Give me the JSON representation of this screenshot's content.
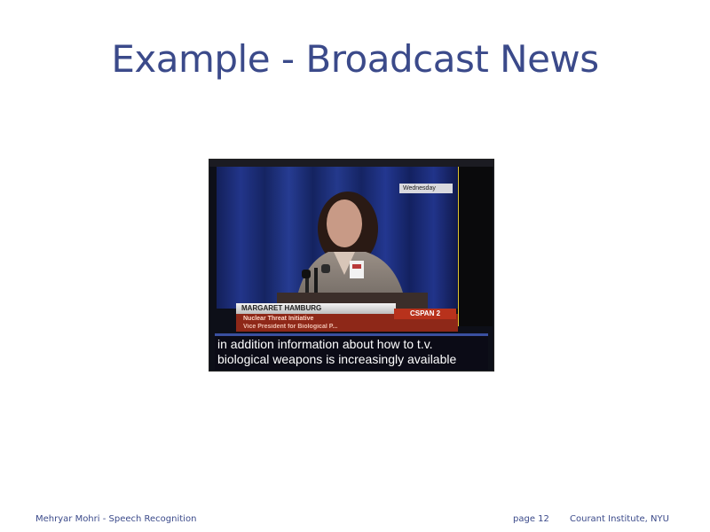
{
  "slide": {
    "title": "Example - Broadcast News"
  },
  "video": {
    "date_tag": "Wednesday",
    "side_menu": [
      "",
      "",
      "",
      "",
      "",
      "",
      "",
      "",
      "",
      ""
    ],
    "name": "MARGARET HAMBURG",
    "org_line1": "Nuclear Threat Initiative",
    "org_line2": "Vice President for Biological P...",
    "network": "CSPAN 2",
    "caption_line1": "in addition information about how to t.v.",
    "caption_line2": "biological weapons is increasingly available"
  },
  "footer": {
    "author": "Mehryar Mohri - Speech Recognition",
    "page": "page   12",
    "institution": "Courant Institute, NYU"
  },
  "colors": {
    "title": "#3b4a8a",
    "curtain": "#1a2a6e",
    "caption_bg": "#0b0b16",
    "network_red": "#b8321c"
  }
}
